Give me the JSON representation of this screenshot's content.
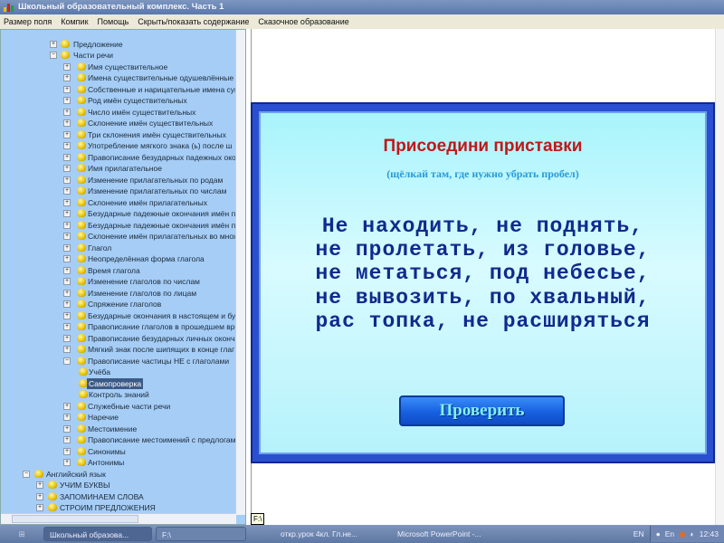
{
  "window": {
    "title": "Школьный образовательный комплекс. Часть 1"
  },
  "menu": [
    "Размер поля",
    "Компик",
    "Помощь",
    "Скрыть/показать содержание",
    "Сказочное образование"
  ],
  "tree": [
    {
      "level": 1,
      "label": "Предложение",
      "exp": "+"
    },
    {
      "level": 1,
      "label": "Части речи",
      "exp": "−"
    },
    {
      "level": 2,
      "label": "Имя существительное",
      "exp": "+"
    },
    {
      "level": 2,
      "label": "Имена существительные одушевлённые и",
      "exp": "+"
    },
    {
      "level": 2,
      "label": "Собственные и нарицательные имена сущ",
      "exp": "+"
    },
    {
      "level": 2,
      "label": "Род имён существительных",
      "exp": "+"
    },
    {
      "level": 2,
      "label": "Число имён существительных",
      "exp": "+"
    },
    {
      "level": 2,
      "label": "Склонение имён существительных",
      "exp": "+"
    },
    {
      "level": 2,
      "label": "Три склонения имён существительных",
      "exp": "+"
    },
    {
      "level": 2,
      "label": "Употребление мягкого знака (ь) после ш",
      "exp": "+"
    },
    {
      "level": 2,
      "label": "Правописание безударных падежных око",
      "exp": "+"
    },
    {
      "level": 2,
      "label": "Имя прилагательное",
      "exp": "+"
    },
    {
      "level": 2,
      "label": "Изменение прилагательных по родам",
      "exp": "+"
    },
    {
      "level": 2,
      "label": "Изменение прилагательных по числам",
      "exp": "+"
    },
    {
      "level": 2,
      "label": "Склонение имён прилагательных",
      "exp": "+"
    },
    {
      "level": 2,
      "label": "Безударные падежные окончания имён п",
      "exp": "+"
    },
    {
      "level": 2,
      "label": "Безударные падежные окончания имён п",
      "exp": "+"
    },
    {
      "level": 2,
      "label": "Склонение имён прилагательных во множ",
      "exp": "+"
    },
    {
      "level": 2,
      "label": "Глагол",
      "exp": "+"
    },
    {
      "level": 2,
      "label": "Неопределённая форма глагола",
      "exp": "+"
    },
    {
      "level": 2,
      "label": "Время глагола",
      "exp": "+"
    },
    {
      "level": 2,
      "label": "Изменение глаголов по числам",
      "exp": "+"
    },
    {
      "level": 2,
      "label": "Изменение глаголов по лицам",
      "exp": "+"
    },
    {
      "level": 2,
      "label": "Спряжение глаголов",
      "exp": "+"
    },
    {
      "level": 2,
      "label": "Безударные окончания в настоящем и бу",
      "exp": "+"
    },
    {
      "level": 2,
      "label": "Правописание глаголов в прошедшем вре",
      "exp": "+"
    },
    {
      "level": 2,
      "label": "Правописание безударных личных оконча",
      "exp": "+"
    },
    {
      "level": 2,
      "label": "Мягкий знак после шипящих в конце глаг",
      "exp": "+"
    },
    {
      "level": 2,
      "label": "Правописание частицы НЕ с глаголами",
      "exp": "−"
    },
    {
      "level": 3,
      "label": "Учёба",
      "exp": ""
    },
    {
      "level": 3,
      "label": "Самопроверка",
      "exp": "",
      "selected": true
    },
    {
      "level": 3,
      "label": "Контроль знаний",
      "exp": ""
    },
    {
      "level": 2,
      "label": "Служебные части речи",
      "exp": "+"
    },
    {
      "level": 2,
      "label": "Наречие",
      "exp": "+"
    },
    {
      "level": 2,
      "label": "Местоимение",
      "exp": "+"
    },
    {
      "level": 2,
      "label": "Правописание местоимений с предлогам",
      "exp": "+"
    },
    {
      "level": 2,
      "label": "Синонимы",
      "exp": "+"
    },
    {
      "level": 2,
      "label": "Антонимы",
      "exp": "+"
    },
    {
      "level": 0,
      "label": "Английский язык",
      "exp": "−"
    },
    {
      "level": 0.6,
      "label": "УЧИМ БУКВЫ",
      "exp": "+"
    },
    {
      "level": 0.6,
      "label": "ЗАПОМИНАЕМ СЛОВА",
      "exp": "+"
    },
    {
      "level": 0.6,
      "label": "СТРОИМ ПРЕДЛОЖЕНИЯ",
      "exp": "+"
    }
  ],
  "slide": {
    "title": "Присоедини приставки",
    "subtitle": "(щёлкай там, где нужно убрать пробел)",
    "lines": [
      "Не находить, не поднять,",
      "не пролетать, из головье,",
      "не метаться, под небесье,",
      "не вывозить, по хвальный,",
      "рас топка, не расширяться"
    ],
    "check_button": "Проверить"
  },
  "tooltip": "F:\\",
  "taskbar": {
    "tasks": [
      "Школьный образова...",
      "F:\\",
      "откр.урок 4кл. Гл.не...",
      "Microsoft PowerPoint -..."
    ],
    "lang": "EN",
    "tray_lang": "En",
    "clock": "12:43"
  }
}
